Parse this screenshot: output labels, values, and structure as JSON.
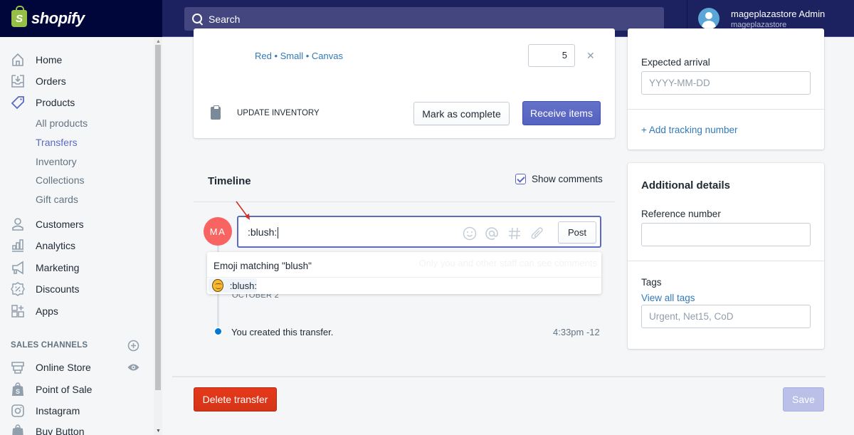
{
  "app": {
    "brand": "shopify",
    "search_placeholder": "Search",
    "user": {
      "name": "mageplazastore Admin",
      "store": "mageplazastore"
    }
  },
  "sidebar": {
    "items": [
      {
        "label": "Home",
        "icon": "home-icon"
      },
      {
        "label": "Orders",
        "icon": "orders-icon"
      },
      {
        "label": "Products",
        "icon": "tag-icon",
        "active": true
      }
    ],
    "product_subitems": [
      {
        "label": "All products"
      },
      {
        "label": "Transfers",
        "active": true
      },
      {
        "label": "Inventory"
      },
      {
        "label": "Collections"
      },
      {
        "label": "Gift cards"
      }
    ],
    "items_lower": [
      {
        "label": "Customers",
        "icon": "person-icon"
      },
      {
        "label": "Analytics",
        "icon": "bar-chart-icon"
      },
      {
        "label": "Marketing",
        "icon": "megaphone-icon"
      },
      {
        "label": "Discounts",
        "icon": "discount-icon"
      },
      {
        "label": "Apps",
        "icon": "apps-icon"
      }
    ],
    "sales_channels_title": "SALES CHANNELS",
    "channels": [
      {
        "label": "Online Store",
        "icon": "store-icon"
      },
      {
        "label": "Point of Sale",
        "icon": "shopping-bag-icon"
      },
      {
        "label": "Instagram",
        "icon": "instagram-icon"
      },
      {
        "label": "Buy Button",
        "icon": "shopping-bag-icon"
      }
    ]
  },
  "product_card": {
    "variant": "Red • Small • Canvas",
    "quantity": "5",
    "update_inventory_label": "UPDATE INVENTORY",
    "mark_complete_label": "Mark as complete",
    "receive_items_label": "Receive items"
  },
  "timeline": {
    "title": "Timeline",
    "show_comments_label": "Show comments",
    "show_comments_checked": true,
    "avatar_initials": "MA",
    "comment_value": ":blush:",
    "post_label": "Post",
    "emoji_popup": {
      "header": "Emoji matching \"blush\"",
      "hint": "Only you and other staff can see comments",
      "option": ":blush:"
    },
    "date_label": "OCTOBER 2",
    "events": [
      {
        "text": "You created this transfer.",
        "time": "4:33pm -12"
      }
    ]
  },
  "shipment_card": {
    "expected_arrival_label": "Expected arrival",
    "expected_arrival_placeholder": "YYYY-MM-DD",
    "add_tracking_label": "+ Add tracking number"
  },
  "additional_details": {
    "title": "Additional details",
    "reference_label": "Reference number",
    "reference_value": "",
    "tags_label": "Tags",
    "view_all_tags_label": "View all tags",
    "tags_placeholder": "Urgent, Net15, CoD"
  },
  "footer": {
    "delete_label": "Delete transfer",
    "save_label": "Save"
  }
}
